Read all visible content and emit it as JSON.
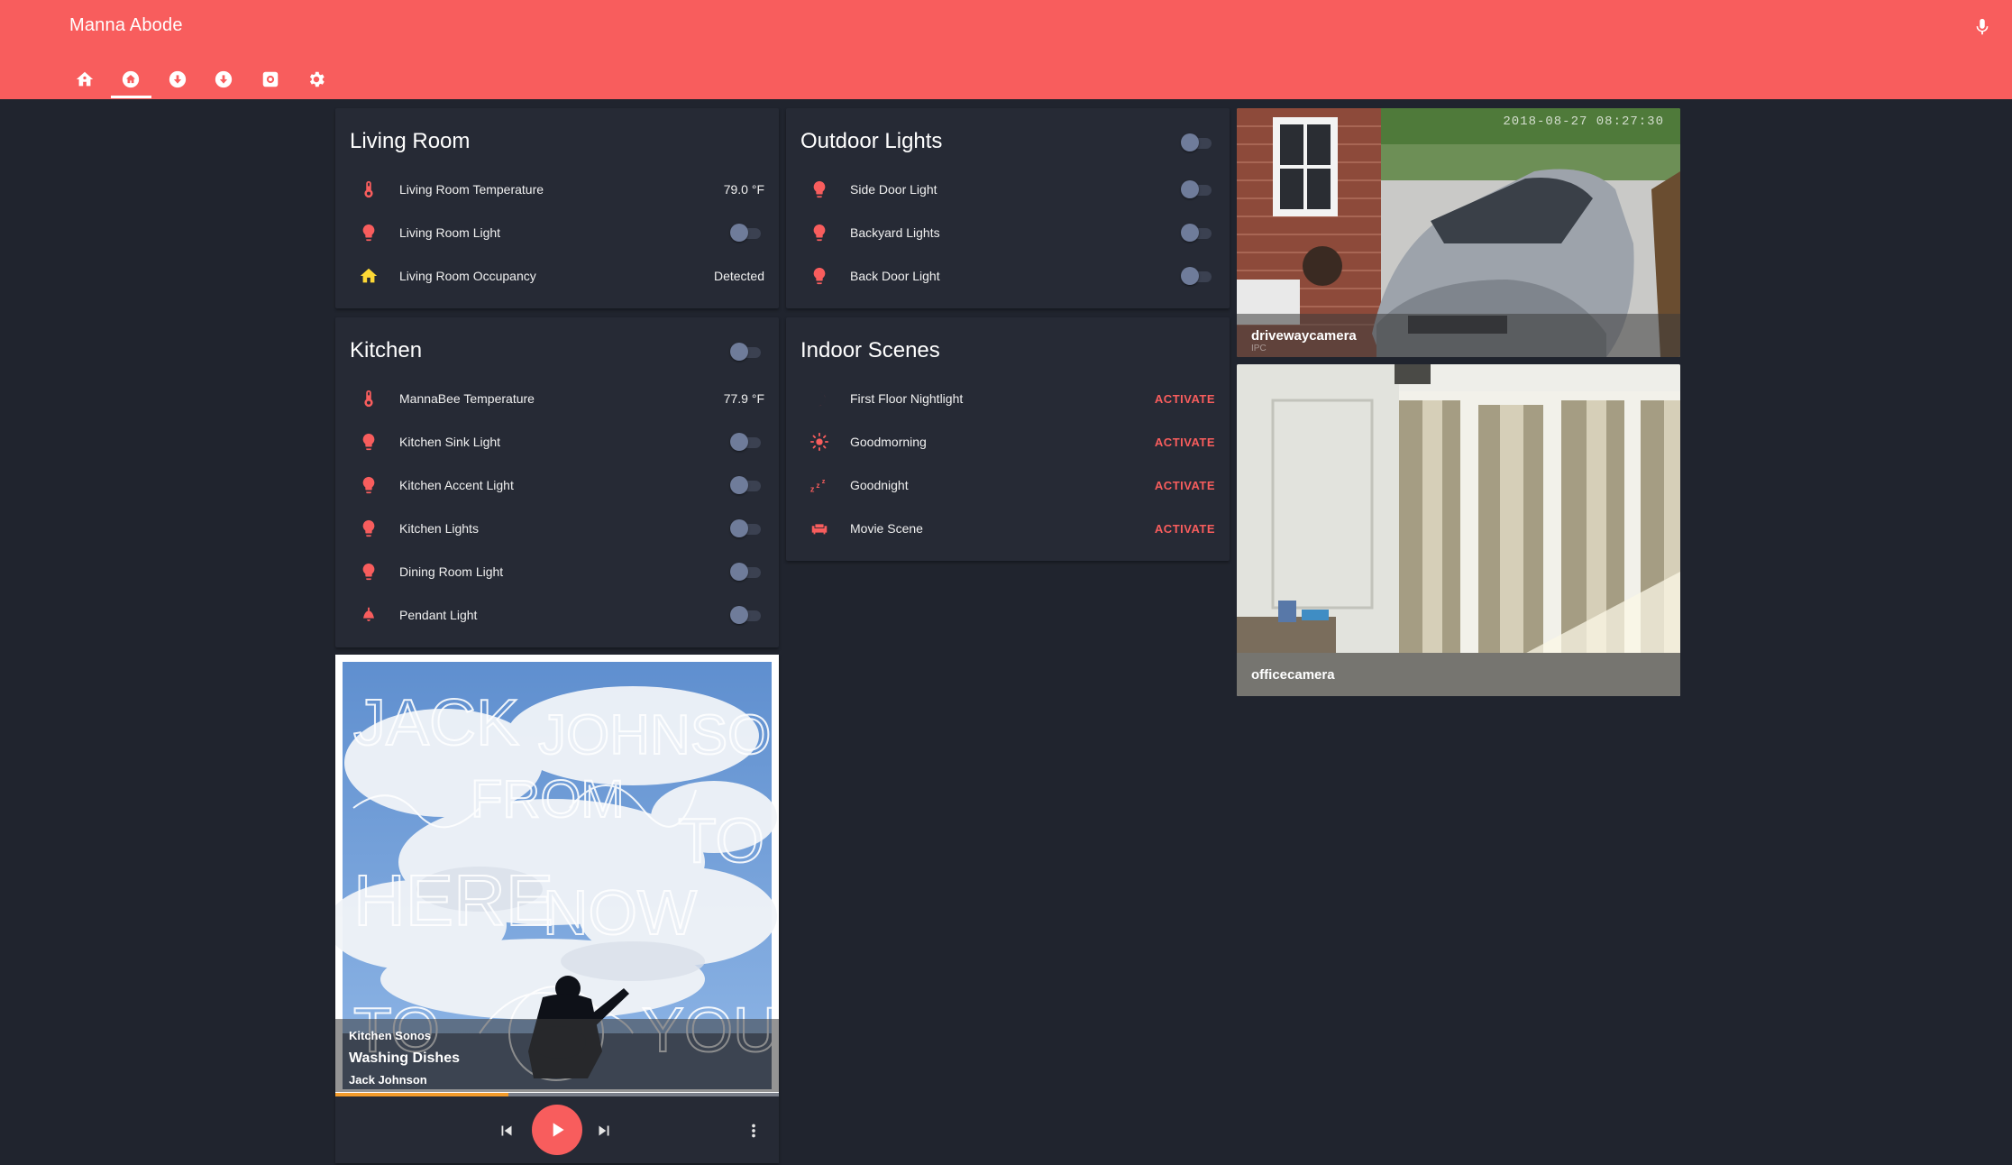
{
  "app": {
    "title": "Manna Abode"
  },
  "header": {
    "tabs": [
      {
        "icon": "house-group-icon",
        "active": false
      },
      {
        "icon": "home-icon",
        "active": true
      },
      {
        "icon": "down-circle-icon",
        "active": false
      },
      {
        "icon": "down-circle-icon",
        "active": false
      },
      {
        "icon": "camera-square-icon",
        "active": false
      },
      {
        "icon": "gear-icon",
        "active": false
      }
    ],
    "mic_icon": "microphone-icon"
  },
  "living_room": {
    "title": "Living Room",
    "rows": [
      {
        "icon": "thermometer-icon",
        "name": "Living Room Temperature",
        "state": "79.0 °F"
      },
      {
        "icon": "lightbulb-icon",
        "name": "Living Room Light",
        "toggle": "off"
      },
      {
        "icon": "home-icon",
        "name": "Living Room Occupancy",
        "state": "Detected"
      }
    ]
  },
  "kitchen": {
    "title": "Kitchen",
    "rows": [
      {
        "icon": "thermometer-icon",
        "name": "MannaBee Temperature",
        "state": "77.9 °F"
      },
      {
        "icon": "lightbulb-icon",
        "name": "Kitchen Sink Light",
        "toggle": "off"
      },
      {
        "icon": "lightbulb-icon",
        "name": "Kitchen Accent Light",
        "toggle": "off"
      },
      {
        "icon": "lightbulb-icon",
        "name": "Kitchen Lights",
        "toggle": "off"
      },
      {
        "icon": "lightbulb-icon",
        "name": "Dining Room Light",
        "toggle": "off"
      },
      {
        "icon": "ceiling-light-icon",
        "name": "Pendant Light",
        "toggle": "off"
      }
    ]
  },
  "outdoor_lights": {
    "title": "Outdoor Lights",
    "rows": [
      {
        "icon": "lightbulb-icon",
        "name": "Side Door Light",
        "toggle": "off"
      },
      {
        "icon": "lightbulb-icon",
        "name": "Backyard Lights",
        "toggle": "off"
      },
      {
        "icon": "lightbulb-icon",
        "name": "Back Door Light",
        "toggle": "off"
      }
    ]
  },
  "indoor_scenes": {
    "title": "Indoor Scenes",
    "activate_label": "ACTIVATE",
    "rows": [
      {
        "icon": "moon-icon",
        "name": "First Floor Nightlight"
      },
      {
        "icon": "sun-icon",
        "name": "Goodmorning"
      },
      {
        "icon": "sleep-icon",
        "name": "Goodnight"
      },
      {
        "icon": "sofa-icon",
        "name": "Movie Scene"
      }
    ]
  },
  "cameras": [
    {
      "name": "drivewaycamera",
      "timestamp": "2018-08-27 08:27:30",
      "small_text": "IPC"
    },
    {
      "name": "officecamera"
    }
  ],
  "media": {
    "source": "Kitchen Sonos",
    "title": "Washing Dishes",
    "artist": "Jack Johnson",
    "progress_fraction": 0.39,
    "album_art_text": [
      "JACK",
      "JOHNSON",
      "FROM",
      "HERE",
      "NOW",
      "TO",
      "TO",
      "YOU"
    ]
  },
  "colors": {
    "accent": "#f85d5d",
    "background": "#20242e",
    "card": "#262a35",
    "progress": "#f39c2c",
    "occupancy": "#fdd835"
  }
}
